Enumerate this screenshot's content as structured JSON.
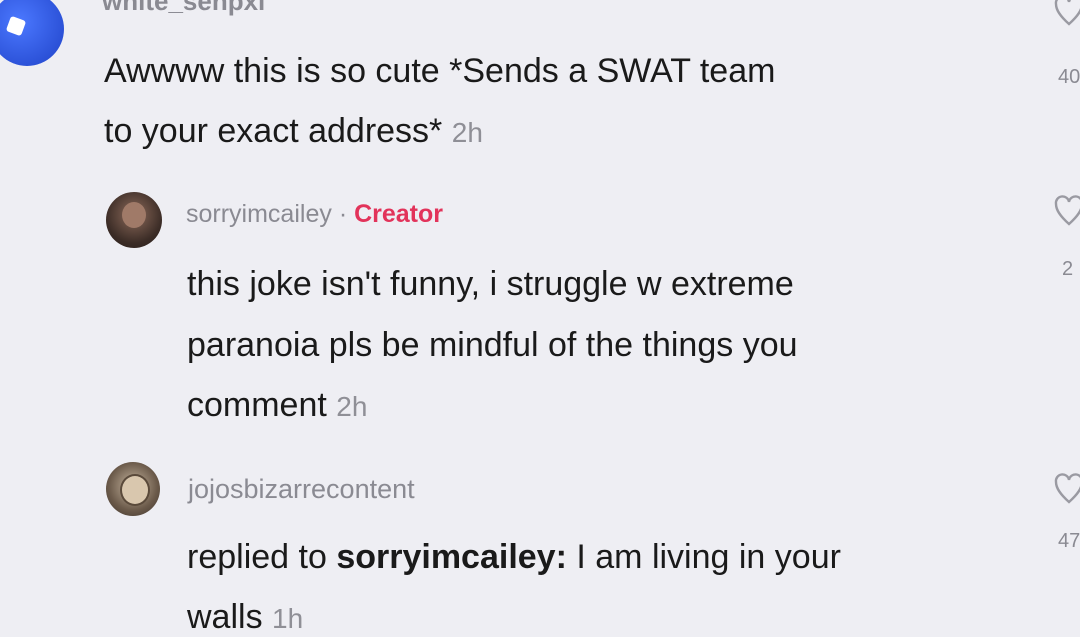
{
  "comments": [
    {
      "username": "white_senpxi",
      "text": "Awwww this is so cute *Sends a SWAT team to your exact address*",
      "line1": "Awwww this is so cute *Sends a SWAT team",
      "line2": "to your exact address*",
      "time": "2h",
      "likes": "40",
      "avatar_icon": "avatar-blue-icon",
      "accent_color": "#2a57e6"
    },
    {
      "username": "sorryimcailey",
      "separator": "·",
      "badge": "Creator",
      "text": "this joke isn't funny, i struggle w extreme paranoia pls be mindful of the things you comment",
      "line1": "this joke isn't funny, i struggle w extreme",
      "line2": "paranoia pls be mindful of the things you",
      "line3": "comment",
      "time": "2h",
      "likes": "2",
      "avatar_icon": "avatar-photo-icon",
      "badge_color": "#e2335a"
    },
    {
      "username": "jojosbizarrecontent",
      "reply_prefix": "replied to",
      "reply_to": "sorryimcailey:",
      "text": "I am living in your walls",
      "line1_rest": "I am living in your",
      "line2": "walls",
      "time": "1h",
      "likes": "47",
      "avatar_icon": "avatar-photo-icon"
    }
  ]
}
